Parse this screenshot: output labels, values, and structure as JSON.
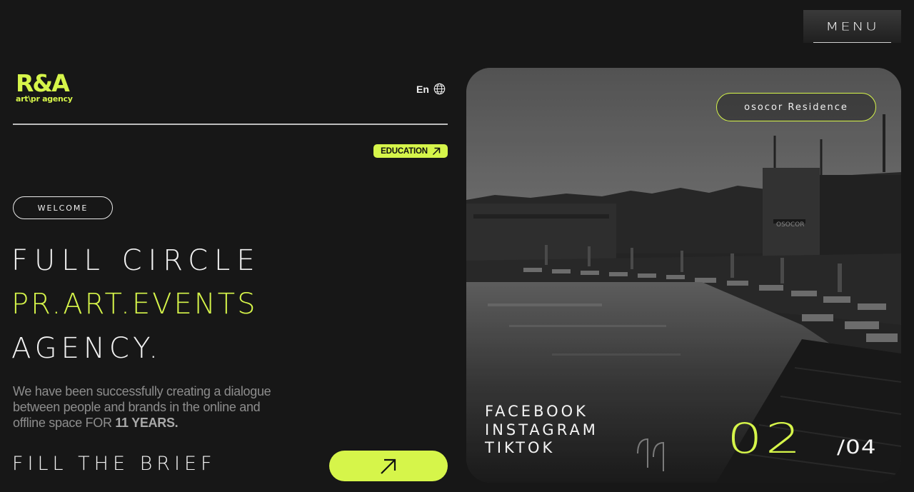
{
  "header": {
    "menu_label": "MENU"
  },
  "logo": {
    "main": "R&A",
    "sub": "art\\pr agency"
  },
  "language": {
    "label": "En",
    "icon": "globe-icon"
  },
  "education_tag": {
    "label": "EDUCATION",
    "icon": "arrow-up-right-icon"
  },
  "welcome_label": "WELCOME",
  "hero": {
    "line1": "FULL CIRCLE",
    "line2": "PR.ART.EVENTS",
    "line3": "AGENCY."
  },
  "description": {
    "text": "We have been successfully creating a dialogue between people and brands in the online and offline space FOR ",
    "highlight": "11 YEARS."
  },
  "brief": {
    "label": "FILL THE BRIEF",
    "icon": "arrow-up-right-icon"
  },
  "slide": {
    "tag": "osocor Residence",
    "building_sign": "OSOCOR",
    "socials": [
      "FACEBOOK",
      "INSTAGRAM",
      "TIKTOK"
    ],
    "current": "02",
    "total": "/04"
  },
  "colors": {
    "accent": "#d6f54a",
    "background": "#171717"
  }
}
